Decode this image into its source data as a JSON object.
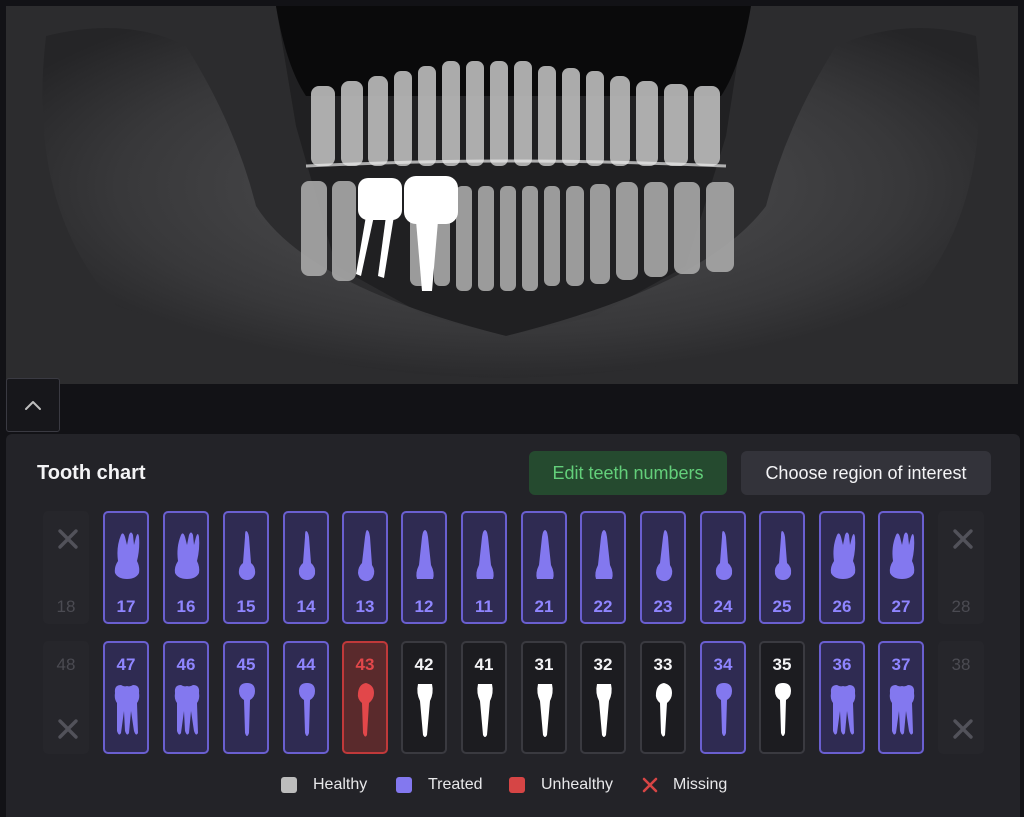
{
  "panel": {
    "title": "Tooth chart",
    "edit_button": "Edit teeth numbers",
    "roi_button": "Choose region of interest"
  },
  "upper_row": [
    {
      "num": "18",
      "status": "missing"
    },
    {
      "num": "17",
      "status": "treated",
      "type": "molar"
    },
    {
      "num": "16",
      "status": "treated",
      "type": "molar"
    },
    {
      "num": "15",
      "status": "treated",
      "type": "premolar"
    },
    {
      "num": "14",
      "status": "treated",
      "type": "premolar"
    },
    {
      "num": "13",
      "status": "treated",
      "type": "canine"
    },
    {
      "num": "12",
      "status": "treated",
      "type": "incisor"
    },
    {
      "num": "11",
      "status": "treated",
      "type": "incisor"
    },
    {
      "num": "21",
      "status": "treated",
      "type": "incisor"
    },
    {
      "num": "22",
      "status": "treated",
      "type": "incisor"
    },
    {
      "num": "23",
      "status": "treated",
      "type": "canine"
    },
    {
      "num": "24",
      "status": "treated",
      "type": "premolar"
    },
    {
      "num": "25",
      "status": "treated",
      "type": "premolar"
    },
    {
      "num": "26",
      "status": "treated",
      "type": "molar"
    },
    {
      "num": "27",
      "status": "treated",
      "type": "molar"
    },
    {
      "num": "28",
      "status": "missing"
    }
  ],
  "lower_row": [
    {
      "num": "48",
      "status": "missing"
    },
    {
      "num": "47",
      "status": "treated",
      "type": "molar"
    },
    {
      "num": "46",
      "status": "treated",
      "type": "molar"
    },
    {
      "num": "45",
      "status": "treated",
      "type": "premolar"
    },
    {
      "num": "44",
      "status": "treated",
      "type": "premolar"
    },
    {
      "num": "43",
      "status": "unhealthy",
      "type": "canine"
    },
    {
      "num": "42",
      "status": "healthy",
      "type": "incisor"
    },
    {
      "num": "41",
      "status": "healthy",
      "type": "incisor"
    },
    {
      "num": "31",
      "status": "healthy",
      "type": "incisor"
    },
    {
      "num": "32",
      "status": "healthy",
      "type": "incisor"
    },
    {
      "num": "33",
      "status": "healthy",
      "type": "canine"
    },
    {
      "num": "34",
      "status": "treated",
      "type": "premolar"
    },
    {
      "num": "35",
      "status": "healthy",
      "type": "premolar"
    },
    {
      "num": "36",
      "status": "treated",
      "type": "molar"
    },
    {
      "num": "37",
      "status": "treated",
      "type": "molar"
    },
    {
      "num": "38",
      "status": "missing"
    }
  ],
  "legend": {
    "healthy": "Healthy",
    "treated": "Treated",
    "unhealthy": "Unhealthy",
    "missing": "Missing"
  },
  "colors": {
    "healthy": "#bdbdbd",
    "treated": "#8378ef",
    "unhealthy": "#d64545",
    "missing": "#d64545",
    "edit_button_text": "#63cf7a"
  },
  "icons": {
    "collapse": "chevron-up-icon",
    "missing": "close-icon"
  }
}
